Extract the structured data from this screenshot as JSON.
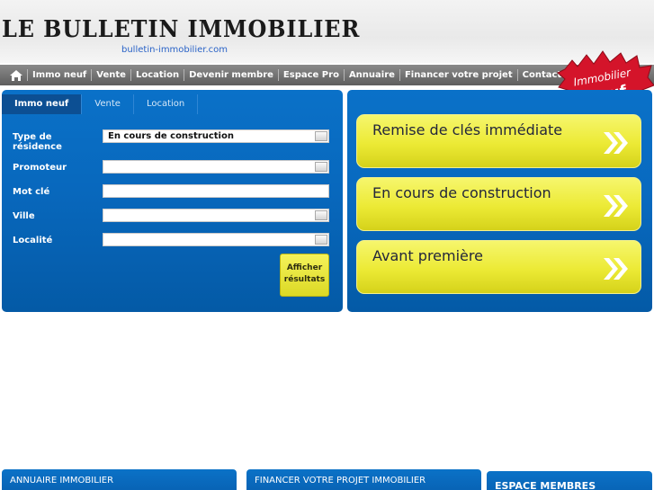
{
  "header": {
    "logo": "LE BULLETIN IMMOBILIER",
    "url": "bulletin-immobilier.com"
  },
  "nav": {
    "items": [
      "Immo neuf",
      "Vente",
      "Location",
      "Devenir membre",
      "Espace Pro",
      "Annuaire",
      "Financer votre projet",
      "Contact"
    ]
  },
  "badge": {
    "line1": "Immobilier",
    "line2": "neuf"
  },
  "search": {
    "tabs": [
      "Immo neuf",
      "Vente",
      "Location"
    ],
    "type_label": "Type de résidence",
    "type_value": "En cours de construction",
    "promoteur_label": "Promoteur",
    "motcle_label": "Mot clé",
    "ville_label": "Ville",
    "localite_label": "Localité",
    "submit": "Afficher résultats"
  },
  "categories": [
    "Remise de clés immédiate",
    "En cours de construction",
    "Avant première"
  ],
  "bottom": {
    "annuaire": "ANNUAIRE IMMOBILIER",
    "financer": "FINANCER VOTRE PROJET IMMOBILIER",
    "espace": "ESPACE MEMBRES"
  },
  "colors": {
    "panel_blue": "#0868bd",
    "accent_yellow": "#ecea35",
    "badge_red": "#d4142a"
  }
}
